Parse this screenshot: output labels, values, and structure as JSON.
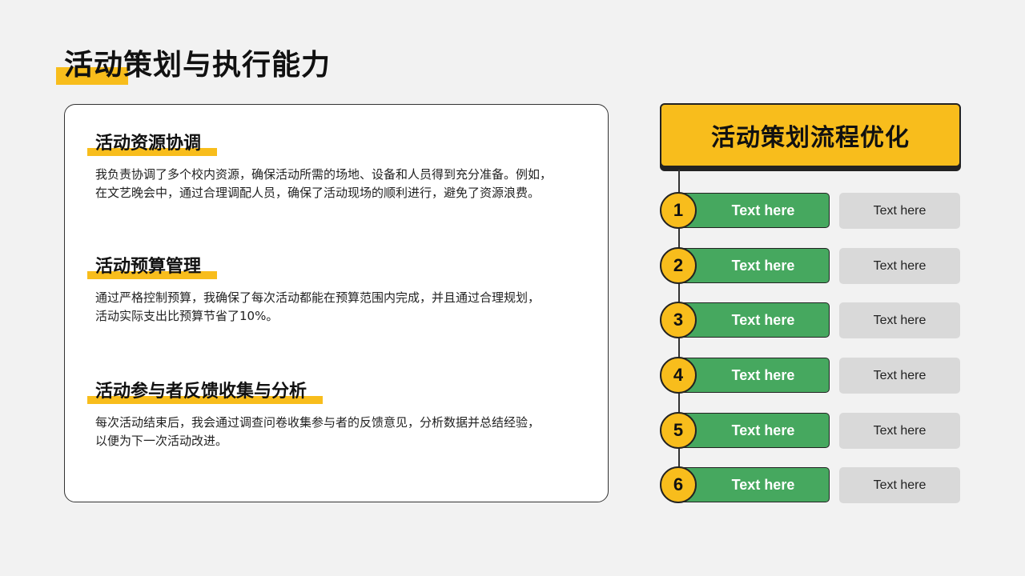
{
  "title": "活动策划与执行能力",
  "sections": [
    {
      "heading": "活动资源协调",
      "body_lines": [
        "我负责协调了多个校内资源，确保活动所需的场地、设备和人员得到充分准备。例如，",
        "在文艺晚会中，通过合理调配人员，确保了活动现场的顺利进行，避免了资源浪费。"
      ]
    },
    {
      "heading": "活动预算管理",
      "body_lines": [
        "通过严格控制预算，我确保了每次活动都能在预算范围内完成，并且通过合理规划，",
        "活动实际支出比预算节省了10%。"
      ]
    },
    {
      "heading": "活动参与者反馈收集与分析",
      "body_lines": [
        "每次活动结束后，我会通过调查问卷收集参与者的反馈意见，分析数据并总结经验，",
        "以便为下一次活动改进。"
      ]
    }
  ],
  "flow": {
    "title": "活动策划流程优化",
    "steps": [
      {
        "num": "1",
        "label": "Text here",
        "detail": "Text here"
      },
      {
        "num": "2",
        "label": "Text here",
        "detail": "Text here"
      },
      {
        "num": "3",
        "label": "Text here",
        "detail": "Text here"
      },
      {
        "num": "4",
        "label": "Text here",
        "detail": "Text here"
      },
      {
        "num": "5",
        "label": "Text here",
        "detail": "Text here"
      },
      {
        "num": "6",
        "label": "Text here",
        "detail": "Text here"
      }
    ]
  },
  "colors": {
    "accent": "#f8bd1c",
    "green": "#46a85f",
    "gray": "#d9d9d9",
    "outline": "#222222"
  }
}
